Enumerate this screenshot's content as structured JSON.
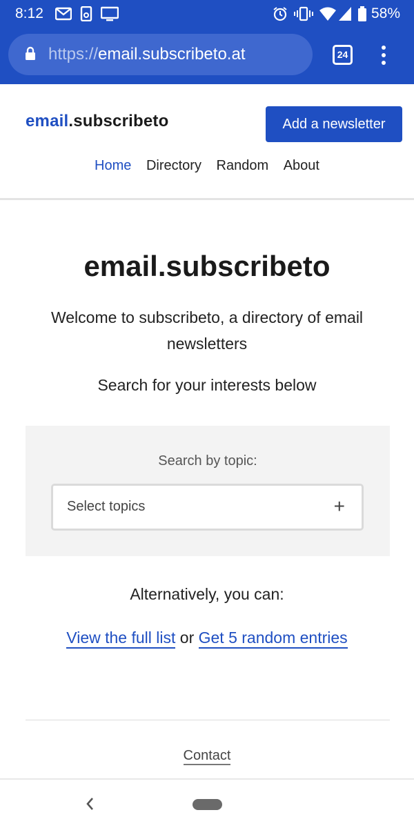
{
  "status_bar": {
    "time": "8:12",
    "battery": "58%",
    "left_icons": [
      "gmail-icon",
      "device-icon",
      "cast-icon"
    ],
    "right_icons": [
      "alarm-icon",
      "vibrate-icon",
      "wifi-icon",
      "signal-icon",
      "battery-icon"
    ]
  },
  "browser": {
    "url_protocol": "https://",
    "url_host": "email.subscribeto.at",
    "tab_count": "24",
    "accent_color": "#1f4fc2"
  },
  "site": {
    "logo_accent": "email",
    "logo_rest": ".subscribeto",
    "add_button": "Add a newsletter",
    "nav": [
      "Home",
      "Directory",
      "Random",
      "About"
    ],
    "active_nav": "Home"
  },
  "hero": {
    "title": "email.subscribeto",
    "subtitle": "Welcome to subscribeto, a directory of email newsletters",
    "search_prompt": "Search for your interests below"
  },
  "search": {
    "label": "Search by topic:",
    "placeholder": "Select topics",
    "add_symbol": "+"
  },
  "alternative": {
    "intro": "Alternatively, you can:",
    "link_full_list": "View the full list",
    "connector": " or ",
    "link_random": "Get 5 random entries"
  },
  "footer": {
    "contact": "Contact"
  }
}
